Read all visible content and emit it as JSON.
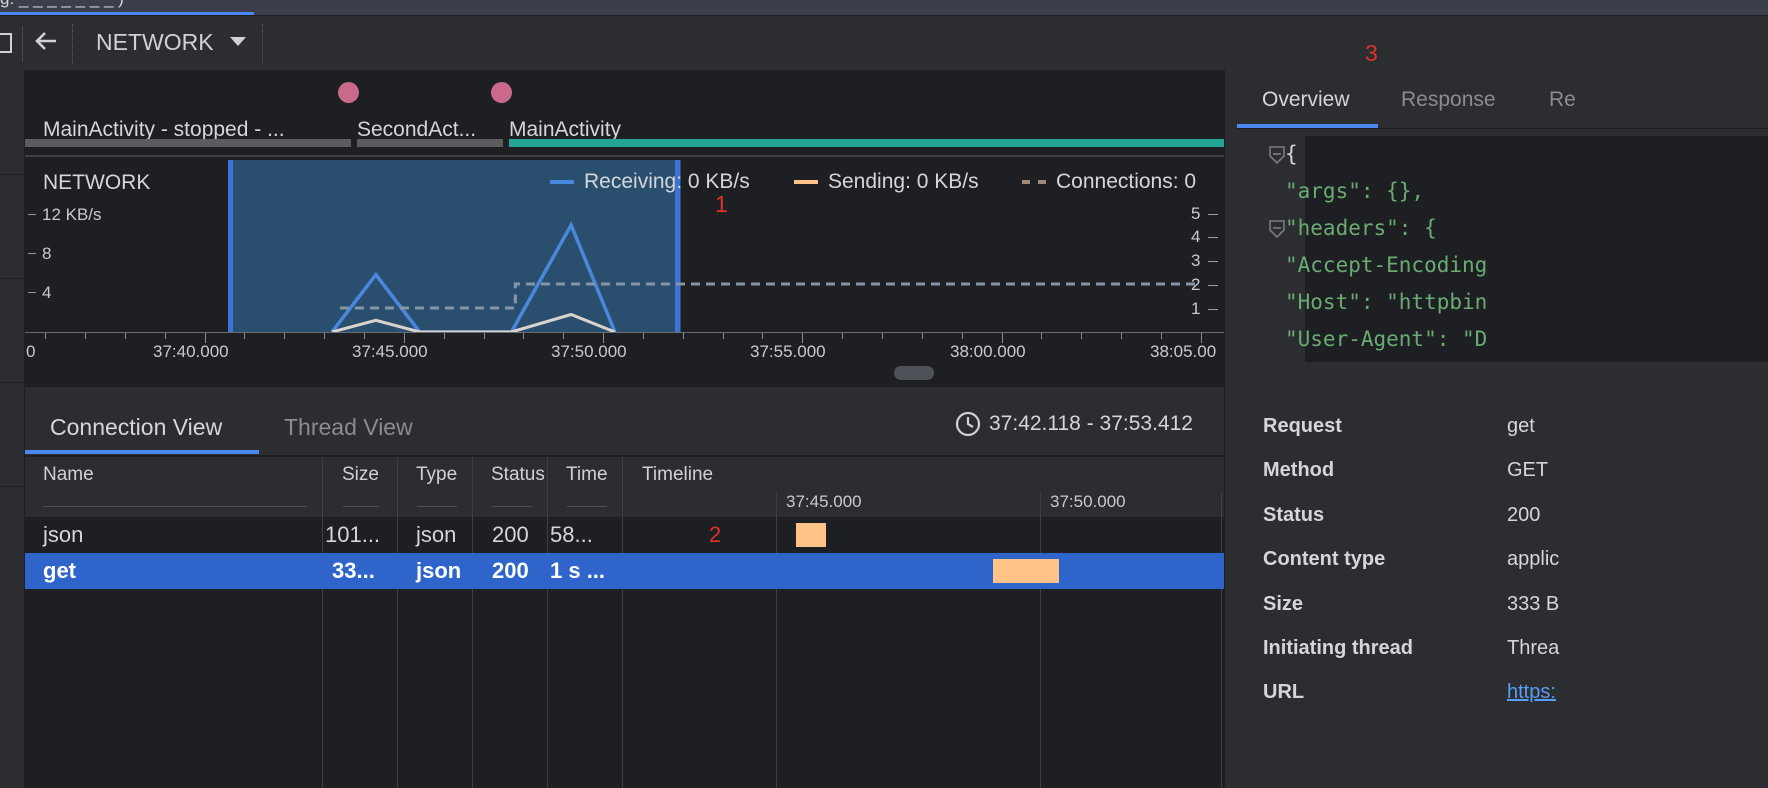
{
  "window": {
    "title": "g:    _ _ _ _ _ _ _ )"
  },
  "toolbar": {
    "view_label": "NETWORK"
  },
  "activities": [
    {
      "label": "MainActivity - stopped - ..."
    },
    {
      "label": "SecondAct..."
    },
    {
      "label": "MainActivity"
    }
  ],
  "chart": {
    "title": "NETWORK",
    "legend": {
      "receiving": "Receiving: 0 KB/s",
      "sending": "Sending: 0 KB/s",
      "connections": "Connections: 0"
    },
    "y_left_ticks": [
      "12 KB/s",
      "8",
      "4"
    ],
    "y_right_ticks": [
      "5",
      "4",
      "3",
      "2",
      "1"
    ],
    "x_ticks": [
      "0",
      "37:40.000",
      "37:45.000",
      "37:50.000",
      "37:55.000",
      "38:00.000",
      "38:05.00"
    ],
    "colors": {
      "receiving": "#4a88dd",
      "sending": "#ffc387",
      "connections": "#a08878",
      "selection": "#2a4f6e",
      "activity_active": "#23a596"
    }
  },
  "chart_data": {
    "type": "line",
    "title": "NETWORK",
    "xlabel": "",
    "ylabel": "",
    "x_ticks": [
      "37:40.000",
      "37:45.000",
      "37:50.000",
      "37:55.000",
      "38:00.000",
      "38:05.00"
    ],
    "ylim": [
      0,
      12
    ],
    "y2lim": [
      0,
      5
    ],
    "series": [
      {
        "name": "Receiving",
        "x": [
          "37:43.2",
          "37:44.3",
          "37:45.4",
          "37:47.7",
          "37:49.2",
          "37:50.3"
        ],
        "values": [
          0,
          5.9,
          0,
          0,
          11,
          0
        ]
      },
      {
        "name": "Sending",
        "x": [
          "37:43.2",
          "37:44.3",
          "37:45.4",
          "37:47.7",
          "37:49.2",
          "37:50.3"
        ],
        "values": [
          0,
          1.2,
          0,
          0,
          1.8,
          0
        ]
      },
      {
        "name": "Connections",
        "x": [
          "37:43.4",
          "37:47.8",
          "37:47.8",
          "38:05.0"
        ],
        "values": [
          1,
          1,
          2,
          2
        ]
      }
    ],
    "selection": [
      "37:42.118",
      "37:53.412"
    ]
  },
  "annotations": {
    "a1": "1",
    "a2": "2",
    "a3": "3"
  },
  "lower": {
    "tabs": [
      {
        "label": "Connection View"
      },
      {
        "label": "Thread View"
      }
    ],
    "range": "37:42.118 - 37:53.412",
    "columns": [
      "Name",
      "Size",
      "Type",
      "Status",
      "Time",
      "Timeline"
    ],
    "timeline_ticks": [
      "37:45.000",
      "37:50.000"
    ],
    "rows": [
      {
        "name": "json",
        "size": "101...",
        "type": "json",
        "status": "200",
        "time": "58...",
        "selected": false
      },
      {
        "name": "get",
        "size": "33...",
        "type": "json",
        "status": "200",
        "time": "1 s ...",
        "selected": true
      }
    ]
  },
  "details": {
    "tabs": [
      {
        "label": "Overview"
      },
      {
        "label": "Response"
      },
      {
        "label": "Re"
      }
    ],
    "json_lines": [
      "{",
      "  \"args\": {},",
      "  \"headers\": {",
      "    \"Accept-Encoding",
      "    \"Host\": \"httpbin",
      "    \"User-Agent\": \"D"
    ],
    "props": [
      {
        "key": "Request",
        "value": "get"
      },
      {
        "key": "Method",
        "value": "GET"
      },
      {
        "key": "Status",
        "value": "200"
      },
      {
        "key": "Content type",
        "value": "applic"
      },
      {
        "key": "Size",
        "value": "333 B"
      },
      {
        "key": "Initiating thread",
        "value": "Threa"
      },
      {
        "key": "URL",
        "value": "https:"
      }
    ]
  }
}
